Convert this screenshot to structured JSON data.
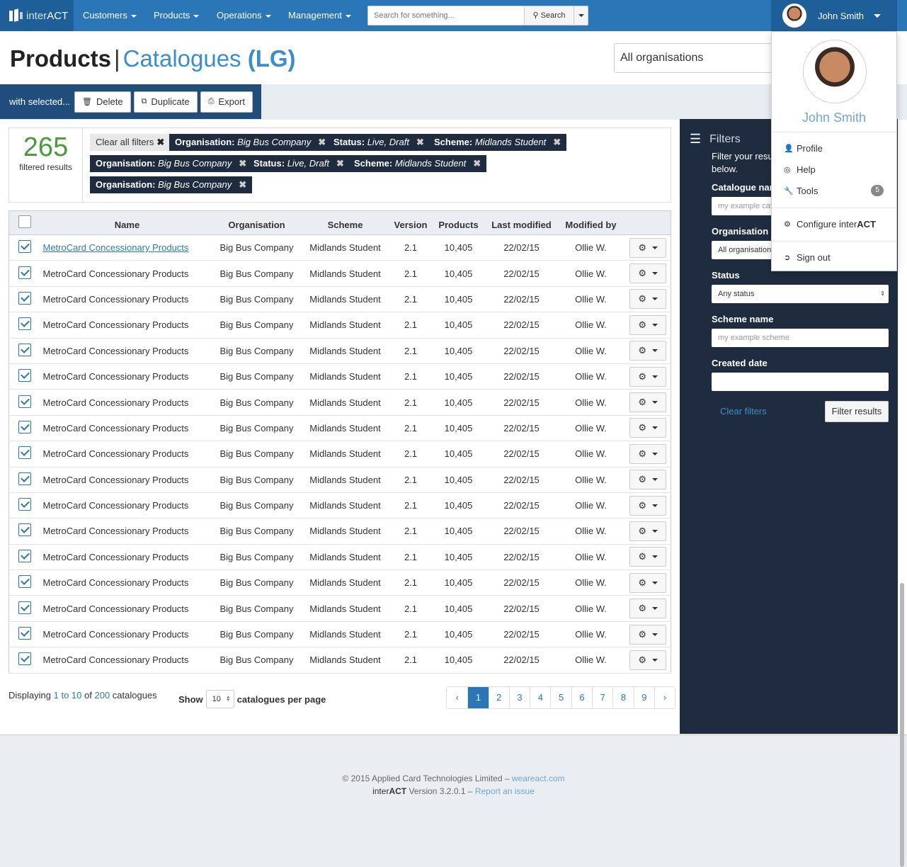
{
  "nav": {
    "brand_pre": "inter",
    "brand_bold": "ACT",
    "items": [
      "Customers",
      "Products",
      "Operations",
      "Management"
    ],
    "search_placeholder": "Search for something...",
    "search_label": "Search",
    "user": "John Smith"
  },
  "page": {
    "title": "Products",
    "subtitle": "Catalogues",
    "code": "(LG)",
    "org_select": "All organisations"
  },
  "toolbar": {
    "with_selected": "with selected...",
    "delete": "Delete",
    "duplicate": "Duplicate",
    "export": "Export"
  },
  "filters_summary": {
    "count": "265",
    "count_label": "filtered results",
    "clear_all": "Clear all filters",
    "tags": [
      {
        "k": "Organisation:",
        "v": "Big Bus Company"
      },
      {
        "k": "Status:",
        "v": "Live, Draft"
      },
      {
        "k": "Scheme:",
        "v": "Midlands Student"
      },
      {
        "k": "Organisation:",
        "v": "Big Bus Company"
      },
      {
        "k": "Status:",
        "v": "Live, Draft"
      },
      {
        "k": "Scheme:",
        "v": "Midlands Student"
      },
      {
        "k": "Organisation:",
        "v": "Big Bus Company"
      }
    ]
  },
  "table": {
    "headers": [
      "Name",
      "Organisation",
      "Scheme",
      "Version",
      "Products",
      "Last modified",
      "Modified by"
    ],
    "row": {
      "name": "MetroCard Concessionary Products",
      "org": "Big Bus Company",
      "scheme": "Midlands Student",
      "version": "2.1",
      "products": "10,405",
      "modified": "22/02/15",
      "by": "Ollie W."
    },
    "row_count": 17
  },
  "pagination": {
    "display_pre": "Displaying",
    "range": "1 to 10",
    "of": "of",
    "total": "200",
    "suffix": "catalogues",
    "show": "Show",
    "per_page": "10",
    "per_page_label": "catalogues per page",
    "pages": [
      "‹",
      "1",
      "2",
      "3",
      "4",
      "5",
      "6",
      "7",
      "8",
      "9",
      "›"
    ],
    "active": "1"
  },
  "sidebar": {
    "title": "Filters",
    "desc1": "Filter your resu",
    "desc2": "below.",
    "catalogue_label": "Catalogue nar",
    "catalogue_ph": "my example cat",
    "org_label": "Organisation",
    "org_value": "All organisation",
    "status_label": "Status",
    "status_value": "Any status",
    "scheme_label": "Scheme name",
    "scheme_ph": "my example scheme",
    "created_label": "Created date",
    "clear": "Clear filters",
    "submit": "Filter results"
  },
  "user_menu": {
    "name": "John Smith",
    "profile": "Profile",
    "help": "Help",
    "tools": "Tools",
    "tools_badge": "5",
    "configure_pre": "Configure inter",
    "configure_bold": "ACT",
    "signout": "Sign out"
  },
  "footer": {
    "copyright": "© 2015 Applied Card Technologies Limited – ",
    "site": "weareact.com",
    "version_pre": "inter",
    "version_bold": "ACT",
    "version": " Version 3.2.0.1 – ",
    "report": "Report an issue"
  }
}
